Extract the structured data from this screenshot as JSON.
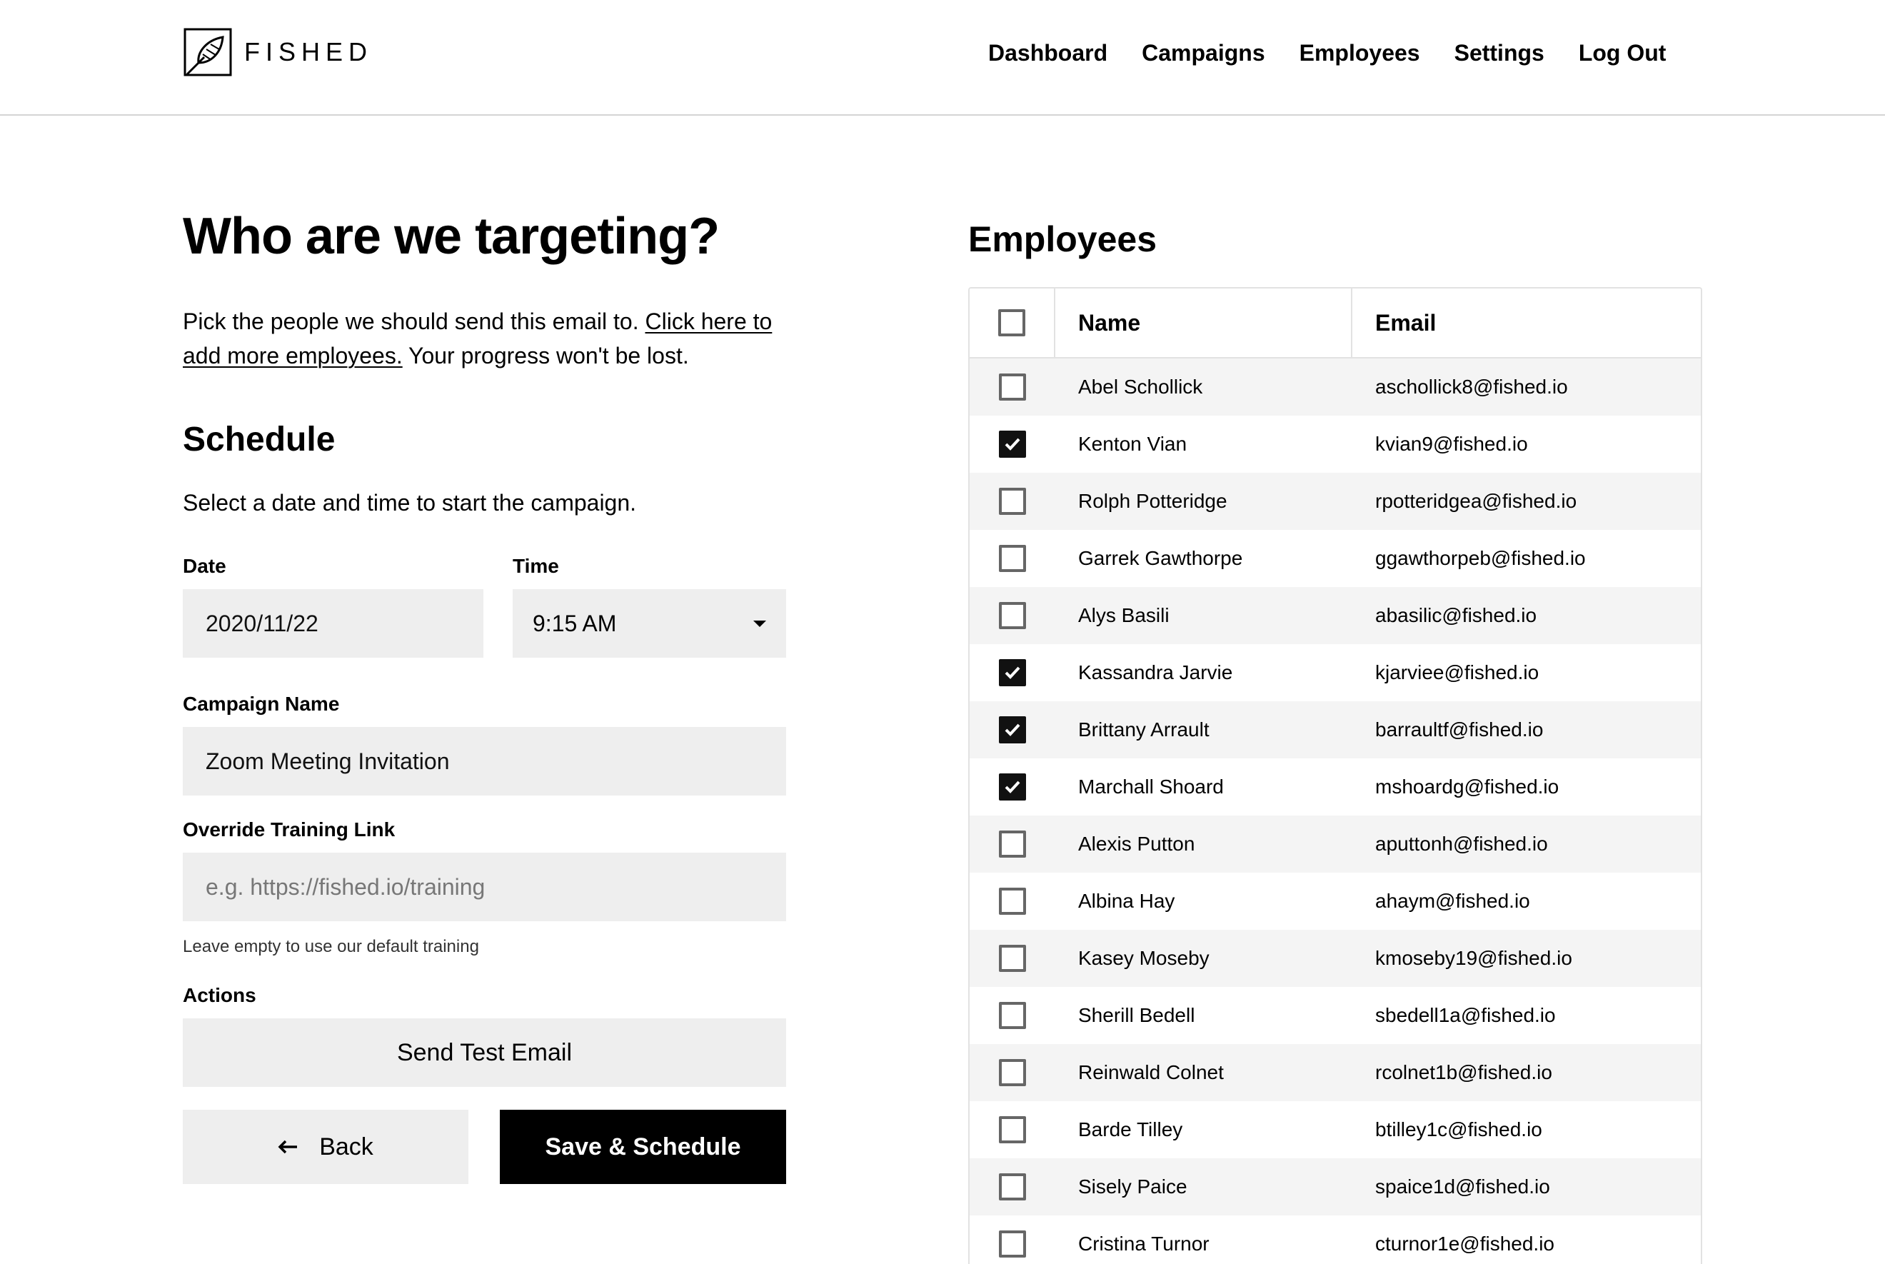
{
  "brand": {
    "name": "FISHED",
    "logo_icon": "feather-in-square-icon"
  },
  "nav": [
    {
      "label": "Dashboard"
    },
    {
      "label": "Campaigns"
    },
    {
      "label": "Employees"
    },
    {
      "label": "Settings"
    },
    {
      "label": "Log Out"
    }
  ],
  "main": {
    "title": "Who are we targeting?",
    "intro_before": "Pick the people we should send this email to. ",
    "intro_link": "Click here to add more employees.",
    "intro_after": " Your progress won't be lost."
  },
  "schedule": {
    "title": "Schedule",
    "description": "Select a date and time to start the campaign.",
    "date_label": "Date",
    "date_value": "2020/11/22",
    "time_label": "Time",
    "time_value": "9:15 AM",
    "campaign_name_label": "Campaign Name",
    "campaign_name_value": "Zoom Meeting Invitation",
    "override_label": "Override Training Link",
    "override_placeholder": "e.g. https://fished.io/training",
    "override_help": "Leave empty to use our default training",
    "actions_label": "Actions",
    "send_test_label": "Send Test Email",
    "back_label": "Back",
    "save_label": "Save & Schedule"
  },
  "employees": {
    "title": "Employees",
    "columns": {
      "name": "Name",
      "email": "Email"
    },
    "header_checked": false,
    "rows": [
      {
        "name": "Abel Schollick",
        "email": "aschollick8@fished.io",
        "checked": false
      },
      {
        "name": "Kenton Vian",
        "email": "kvian9@fished.io",
        "checked": true
      },
      {
        "name": "Rolph Potteridge",
        "email": "rpotteridgea@fished.io",
        "checked": false
      },
      {
        "name": "Garrek Gawthorpe",
        "email": "ggawthorpeb@fished.io",
        "checked": false
      },
      {
        "name": "Alys Basili",
        "email": "abasilic@fished.io",
        "checked": false
      },
      {
        "name": "Kassandra Jarvie",
        "email": "kjarviee@fished.io",
        "checked": true
      },
      {
        "name": "Brittany Arrault",
        "email": "barraultf@fished.io",
        "checked": true
      },
      {
        "name": "Marchall Shoard",
        "email": "mshoardg@fished.io",
        "checked": true
      },
      {
        "name": "Alexis Putton",
        "email": "aputtonh@fished.io",
        "checked": false
      },
      {
        "name": "Albina Hay",
        "email": "ahaym@fished.io",
        "checked": false
      },
      {
        "name": "Kasey Moseby",
        "email": "kmoseby19@fished.io",
        "checked": false
      },
      {
        "name": "Sherill Bedell",
        "email": "sbedell1a@fished.io",
        "checked": false
      },
      {
        "name": "Reinwald Colnet",
        "email": "rcolnet1b@fished.io",
        "checked": false
      },
      {
        "name": "Barde Tilley",
        "email": "btilley1c@fished.io",
        "checked": false
      },
      {
        "name": "Sisely Paice",
        "email": "spaice1d@fished.io",
        "checked": false
      },
      {
        "name": "Cristina Turnor",
        "email": "cturnor1e@fished.io",
        "checked": false
      }
    ]
  }
}
